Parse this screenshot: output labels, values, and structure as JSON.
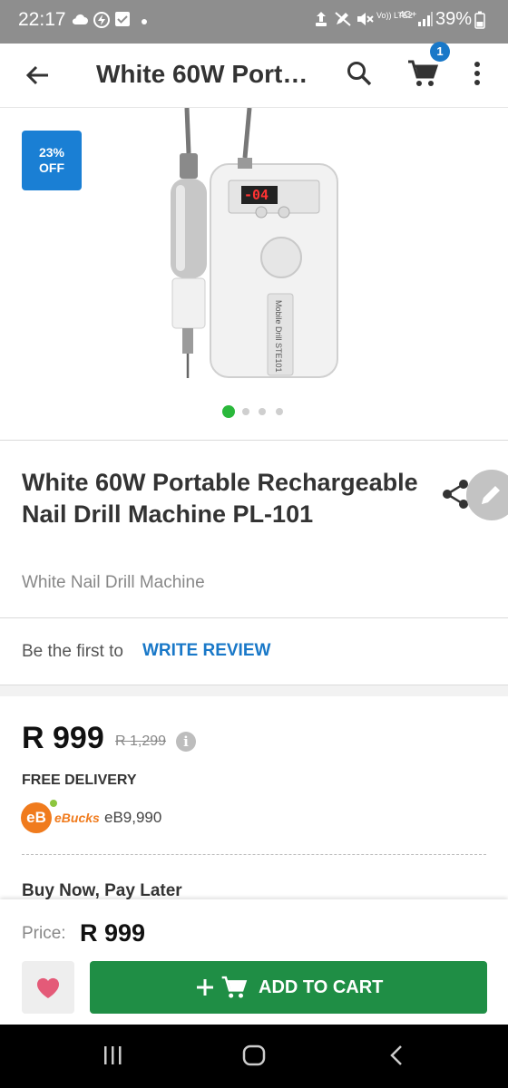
{
  "status_bar": {
    "time": "22:17",
    "network": "Vo)) LTE2",
    "signal_type": "4G+",
    "battery": "39%"
  },
  "header": {
    "title": "White 60W Port…",
    "cart_count": "1",
    "icons": [
      "back-arrow-icon",
      "search-icon",
      "cart-icon",
      "more-vert-icon"
    ]
  },
  "product": {
    "discount_line1": "23%",
    "discount_line2": "OFF",
    "image_indicator": {
      "count": 4,
      "active": 1
    },
    "title": "White 60W Portable Rechargeable Nail Drill Machine PL-101",
    "subtitle": "White Nail Drill Machine",
    "device_display": "-04",
    "device_label": "Mobile Drill STE101"
  },
  "review": {
    "prompt": "Be the first to",
    "link": "WRITE REVIEW"
  },
  "pricing": {
    "price": "R 999",
    "old_price": "R 1,299",
    "info_icon": "i",
    "free_delivery": "FREE DELIVERY",
    "ebucks_logo": "eB",
    "ebucks_brand": "eBucks",
    "ebucks_value": "eB9,990",
    "bnpl": "Buy Now, Pay Later"
  },
  "bottom_bar": {
    "price_label": "Price:",
    "price_value": "R 999",
    "add_to_cart": "ADD TO CART"
  },
  "colors": {
    "accent_blue": "#1978c8",
    "cart_green": "#1f8e45",
    "indicator_green": "#2ab83b",
    "heart_pink": "#e45a78",
    "ebucks_orange": "#f07b1d"
  }
}
